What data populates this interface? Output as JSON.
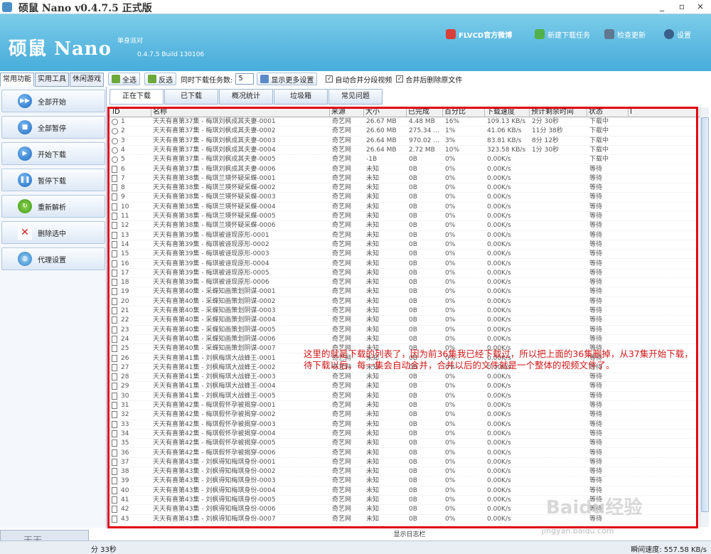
{
  "window": {
    "title": "硕鼠 Nano v0.4.7.5 正式版",
    "min": "_",
    "max": "▫",
    "close": "×"
  },
  "header": {
    "logo": "硕鼠 Nano",
    "edition": "单身派对",
    "build": "0.4.7.5 Build 130106",
    "links": [
      "FLVCD官方微博",
      "新建下载任务",
      "检查更新",
      "设置"
    ]
  },
  "side_tabs": [
    "常用功能",
    "实用工具",
    "休闲游戏"
  ],
  "side_buttons": [
    "全部开始",
    "全部暂停",
    "开始下载",
    "暂停下载",
    "重新解析",
    "删除选中",
    "代理设置"
  ],
  "toolbar": {
    "select_all": "全选",
    "invert": "反选",
    "concurrent_label": "同时下载任务数:",
    "concurrent_value": "5",
    "more": "显示更多设置",
    "auto_merge": "自动合并分段视频",
    "delete_after": "合并后删除原文件"
  },
  "tabs": [
    "正在下载",
    "已下载",
    "概况统计",
    "垃圾箱",
    "常见问题"
  ],
  "columns": [
    "ID",
    "名称",
    "来源",
    "大小",
    "已完成",
    "百分比",
    "下载速度",
    "预计剩余时间",
    "状态",
    "I"
  ],
  "rows": [
    [
      "1",
      "天天有喜第37集 - 梅琪刘枫成其夫妻-0001",
      "奇艺网",
      "26.67 MB",
      "4.48 MB",
      "16%",
      "109.13 KB/s",
      "2分 30秒",
      "下载中"
    ],
    [
      "2",
      "天天有喜第37集 - 梅琪刘枫成其夫妻-0002",
      "奇艺网",
      "26.60 MB",
      "275.34 ...",
      "1%",
      "41.06 KB/s",
      "11分 38秒",
      "下载中"
    ],
    [
      "3",
      "天天有喜第37集 - 梅琪刘枫成其夫妻-0003",
      "奇艺网",
      "26.64 MB",
      "970.02 ...",
      "3%",
      "83.81 KB/s",
      "8分 12秒",
      "下载中"
    ],
    [
      "4",
      "天天有喜第37集 - 梅琪刘枫成其夫妻-0004",
      "奇艺网",
      "26.64 MB",
      "2.72 MB",
      "10%",
      "323.58 KB/s",
      "1分 30秒",
      "下载中"
    ],
    [
      "5",
      "天天有喜第37集 - 梅琪刘枫成其夫妻-0005",
      "奇艺网",
      "-1B",
      "0B",
      "0%",
      "0.00K/s",
      "",
      "下载中"
    ],
    [
      "6",
      "天天有喜第37集 - 梅琪刘枫成其夫妻-0006",
      "奇艺网",
      "未知",
      "0B",
      "0%",
      "0.00K/s",
      "",
      "等待"
    ],
    [
      "7",
      "天天有喜第38集 - 梅琪兰瑛怀疑采蝶-0001",
      "奇艺网",
      "未知",
      "0B",
      "0%",
      "0.00K/s",
      "",
      "等待"
    ],
    [
      "8",
      "天天有喜第38集 - 梅琪兰瑛怀疑采蝶-0002",
      "奇艺网",
      "未知",
      "0B",
      "0%",
      "0.00K/s",
      "",
      "等待"
    ],
    [
      "9",
      "天天有喜第38集 - 梅琪兰瑛怀疑采蝶-0003",
      "奇艺网",
      "未知",
      "0B",
      "0%",
      "0.00K/s",
      "",
      "等待"
    ],
    [
      "10",
      "天天有喜第38集 - 梅琪兰瑛怀疑采蝶-0004",
      "奇艺网",
      "未知",
      "0B",
      "0%",
      "0.00K/s",
      "",
      "等待"
    ],
    [
      "11",
      "天天有喜第38集 - 梅琪兰瑛怀疑采蝶-0005",
      "奇艺网",
      "未知",
      "0B",
      "0%",
      "0.00K/s",
      "",
      "等待"
    ],
    [
      "12",
      "天天有喜第38集 - 梅琪兰瑛怀疑采蝶-0006",
      "奇艺网",
      "未知",
      "0B",
      "0%",
      "0.00K/s",
      "",
      "等待"
    ],
    [
      "13",
      "天天有喜第39集 - 梅琪被诬现原形-0001",
      "奇艺网",
      "未知",
      "0B",
      "0%",
      "0.00K/s",
      "",
      "等待"
    ],
    [
      "14",
      "天天有喜第39集 - 梅琪被诬现原形-0002",
      "奇艺网",
      "未知",
      "0B",
      "0%",
      "0.00K/s",
      "",
      "等待"
    ],
    [
      "15",
      "天天有喜第39集 - 梅琪被诬现原形-0003",
      "奇艺网",
      "未知",
      "0B",
      "0%",
      "0.00K/s",
      "",
      "等待"
    ],
    [
      "16",
      "天天有喜第39集 - 梅琪被诬现原形-0004",
      "奇艺网",
      "未知",
      "0B",
      "0%",
      "0.00K/s",
      "",
      "等待"
    ],
    [
      "17",
      "天天有喜第39集 - 梅琪被诬现原形-0005",
      "奇艺网",
      "未知",
      "0B",
      "0%",
      "0.00K/s",
      "",
      "等待"
    ],
    [
      "18",
      "天天有喜第39集 - 梅琪被诬现原形-0006",
      "奇艺网",
      "未知",
      "0B",
      "0%",
      "0.00K/s",
      "",
      "等待"
    ],
    [
      "19",
      "天天有喜第40集 - 采蝶知画策划阴谋-0001",
      "奇艺网",
      "未知",
      "0B",
      "0%",
      "0.00K/s",
      "",
      "等待"
    ],
    [
      "20",
      "天天有喜第40集 - 采蝶知画策划阴谋-0002",
      "奇艺网",
      "未知",
      "0B",
      "0%",
      "0.00K/s",
      "",
      "等待"
    ],
    [
      "21",
      "天天有喜第40集 - 采蝶知画策划阴谋-0003",
      "奇艺网",
      "未知",
      "0B",
      "0%",
      "0.00K/s",
      "",
      "等待"
    ],
    [
      "22",
      "天天有喜第40集 - 采蝶知画策划阴谋-0004",
      "奇艺网",
      "未知",
      "0B",
      "0%",
      "0.00K/s",
      "",
      "等待"
    ],
    [
      "23",
      "天天有喜第40集 - 采蝶知画策划阴谋-0005",
      "奇艺网",
      "未知",
      "0B",
      "0%",
      "0.00K/s",
      "",
      "等待"
    ],
    [
      "24",
      "天天有喜第40集 - 采蝶知画策划阴谋-0006",
      "奇艺网",
      "未知",
      "0B",
      "0%",
      "0.00K/s",
      "",
      "等待"
    ],
    [
      "25",
      "天天有喜第40集 - 采蝶知画策划阴谋-0007",
      "奇艺网",
      "未知",
      "0B",
      "0%",
      "0.00K/s",
      "",
      "等待"
    ],
    [
      "26",
      "天天有喜第41集 - 刘枫梅琪大战蜂王-0001",
      "奇艺网",
      "未知",
      "0B",
      "0%",
      "0.00K/s",
      "",
      "等待"
    ],
    [
      "27",
      "天天有喜第41集 - 刘枫梅琪大战蜂王-0002",
      "奇艺网",
      "未知",
      "0B",
      "0%",
      "0.00K/s",
      "",
      "等待"
    ],
    [
      "28",
      "天天有喜第41集 - 刘枫梅琪大战蜂王-0003",
      "奇艺网",
      "未知",
      "0B",
      "0%",
      "0.00K/s",
      "",
      "等待"
    ],
    [
      "29",
      "天天有喜第41集 - 刘枫梅琪大战蜂王-0004",
      "奇艺网",
      "未知",
      "0B",
      "0%",
      "0.00K/s",
      "",
      "等待"
    ],
    [
      "30",
      "天天有喜第41集 - 刘枫梅琪大战蜂王-0005",
      "奇艺网",
      "未知",
      "0B",
      "0%",
      "0.00K/s",
      "",
      "等待"
    ],
    [
      "31",
      "天天有喜第42集 - 梅琪假怀孕被揭穿-0001",
      "奇艺网",
      "未知",
      "0B",
      "0%",
      "0.00K/s",
      "",
      "等待"
    ],
    [
      "32",
      "天天有喜第42集 - 梅琪假怀孕被揭穿-0002",
      "奇艺网",
      "未知",
      "0B",
      "0%",
      "0.00K/s",
      "",
      "等待"
    ],
    [
      "33",
      "天天有喜第42集 - 梅琪假怀孕被揭穿-0003",
      "奇艺网",
      "未知",
      "0B",
      "0%",
      "0.00K/s",
      "",
      "等待"
    ],
    [
      "34",
      "天天有喜第42集 - 梅琪假怀孕被揭穿-0004",
      "奇艺网",
      "未知",
      "0B",
      "0%",
      "0.00K/s",
      "",
      "等待"
    ],
    [
      "35",
      "天天有喜第42集 - 梅琪假怀孕被揭穿-0005",
      "奇艺网",
      "未知",
      "0B",
      "0%",
      "0.00K/s",
      "",
      "等待"
    ],
    [
      "36",
      "天天有喜第42集 - 梅琪假怀孕被揭穿-0006",
      "奇艺网",
      "未知",
      "0B",
      "0%",
      "0.00K/s",
      "",
      "等待"
    ],
    [
      "37",
      "天天有喜第43集 - 刘枫得知梅琪身份-0001",
      "奇艺网",
      "未知",
      "0B",
      "0%",
      "0.00K/s",
      "",
      "等待"
    ],
    [
      "38",
      "天天有喜第43集 - 刘枫得知梅琪身份-0002",
      "奇艺网",
      "未知",
      "0B",
      "0%",
      "0.00K/s",
      "",
      "等待"
    ],
    [
      "39",
      "天天有喜第43集 - 刘枫得知梅琪身份-0003",
      "奇艺网",
      "未知",
      "0B",
      "0%",
      "0.00K/s",
      "",
      "等待"
    ],
    [
      "40",
      "天天有喜第43集 - 刘枫得知梅琪身份-0004",
      "奇艺网",
      "未知",
      "0B",
      "0%",
      "0.00K/s",
      "",
      "等待"
    ],
    [
      "41",
      "天天有喜第43集 - 刘枫得知梅琪身份-0005",
      "奇艺网",
      "未知",
      "0B",
      "0%",
      "0.00K/s",
      "",
      "等待"
    ],
    [
      "42",
      "天天有喜第43集 - 刘枫得知梅琪身份-0006",
      "奇艺网",
      "未知",
      "0B",
      "0%",
      "0.00K/s",
      "",
      "等待"
    ],
    [
      "43",
      "天天有喜第43集 - 刘枫得知梅琪身份-0007",
      "奇艺网",
      "未知",
      "0B",
      "0%",
      "0.00K/s",
      "",
      "等待"
    ]
  ],
  "annotation": "这里的就是下载的列表了，因为前36集我已经下载过，所以把上面的36集删掉，从37集开始下载，待下载以后，每一集会自动合并，合并以后的文件就是一个整体的视频文件了。",
  "log_bar": "显示日志栏",
  "mini_window": "天天...",
  "status": {
    "left": "分 33秒",
    "right": "瞬间速度: 557.58 KB/s"
  },
  "watermark": {
    "main": "Baidu经验",
    "sub": "jingyan.baidu.com"
  },
  "colors": {
    "header_bg": "#5bb8e0",
    "highlight": "#e00010"
  }
}
